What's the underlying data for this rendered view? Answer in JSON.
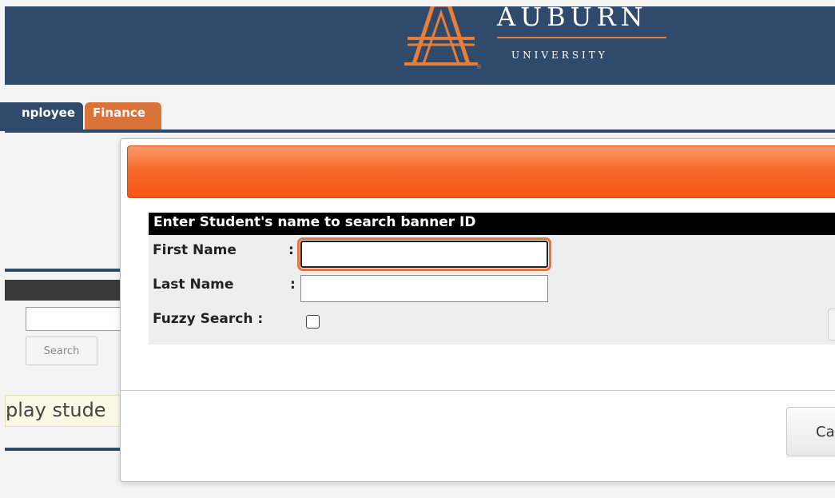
{
  "header": {
    "logo_title": "AUBURN",
    "logo_subtitle": "UNIVERSITY",
    "brand_color": "#2f4a6b",
    "accent_color": "#e67e3a"
  },
  "tabs": [
    {
      "label": "nployee",
      "color": "#2f4a6b"
    },
    {
      "label": "Finance",
      "color": "#d9733a"
    }
  ],
  "left_panel": {
    "search_button": "Search",
    "message": "play stude"
  },
  "dialog": {
    "form_header": "Enter Student's name to search banner ID",
    "first_name_label": "First Name",
    "first_name_value": "",
    "last_name_label": "Last Name",
    "last_name_value": "",
    "fuzzy_label": "Fuzzy Search :",
    "colon": ":",
    "cancel_button": "Ca"
  }
}
